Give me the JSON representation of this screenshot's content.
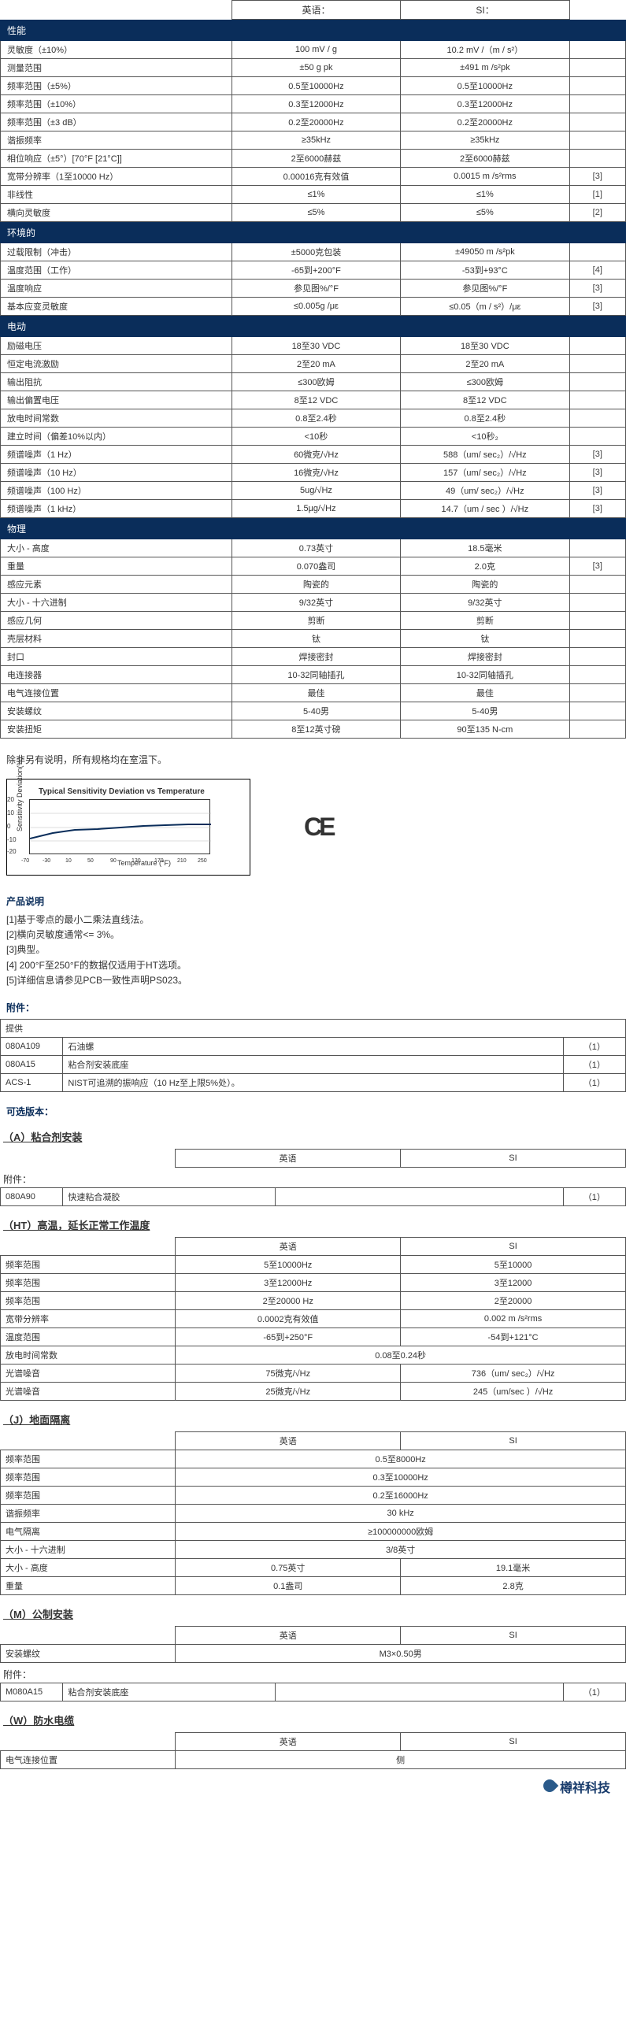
{
  "top_header": {
    "en_label": "英语：",
    "si_label": "SI："
  },
  "sections": [
    {
      "title": "性能",
      "rows": [
        {
          "label": "灵敏度（±10%）",
          "en": "100 mV / g",
          "si": "10.2 mV /（m / s²）",
          "note": ""
        },
        {
          "label": "测量范围",
          "en": "±50 g pk",
          "si": "±491 m /s²pk",
          "note": ""
        },
        {
          "label": "频率范围（±5%）",
          "en": "0.5至10000Hz",
          "si": "0.5至10000Hz",
          "note": ""
        },
        {
          "label": "频率范围（±10%）",
          "en": "0.3至12000Hz",
          "si": "0.3至12000Hz",
          "note": ""
        },
        {
          "label": "频率范围（±3 dB）",
          "en": "0.2至20000Hz",
          "si": "0.2至20000Hz",
          "note": ""
        },
        {
          "label": "谐振频率",
          "en": "≥35kHz",
          "si": "≥35kHz",
          "note": ""
        },
        {
          "label": "相位响应（±5°）[70°F [21°C]]",
          "en": "2至6000赫兹",
          "si": "2至6000赫兹",
          "note": ""
        },
        {
          "label": "宽带分辨率（1至10000 Hz）",
          "en": "0.00016克有效值",
          "si": "0.0015 m /s²rms",
          "note": "[3]"
        },
        {
          "label": "非线性",
          "en": "≤1%",
          "si": "≤1%",
          "note": "[1]"
        },
        {
          "label": "横向灵敏度",
          "en": "≤5%",
          "si": "≤5%",
          "note": "[2]"
        }
      ]
    },
    {
      "title": "环境的",
      "rows": [
        {
          "label": "过载限制（冲击）",
          "en": "±5000克包装",
          "si": "±49050 m /s²pk",
          "note": ""
        },
        {
          "label": "温度范围（工作）",
          "en": "-65到+200°F",
          "si": "-53到+93°C",
          "note": "[4]"
        },
        {
          "label": "温度响应",
          "en": "参见图%/°F",
          "si": "参见图%/°F",
          "note": "[3]"
        },
        {
          "label": "基本应变灵敏度",
          "en": "≤0.005g /με",
          "si": "≤0.05（m / s²）/με",
          "note": "[3]"
        }
      ]
    },
    {
      "title": "电动",
      "rows": [
        {
          "label": "励磁电压",
          "en": "18至30 VDC",
          "si": "18至30 VDC",
          "note": ""
        },
        {
          "label": "恒定电流激励",
          "en": "2至20 mA",
          "si": "2至20 mA",
          "note": ""
        },
        {
          "label": "输出阻抗",
          "en": "≤300欧姆",
          "si": "≤300欧姆",
          "note": ""
        },
        {
          "label": "输出偏置电压",
          "en": "8至12 VDC",
          "si": "8至12 VDC",
          "note": ""
        },
        {
          "label": "放电时间常数",
          "en": "0.8至2.4秒",
          "si": "0.8至2.4秒",
          "note": ""
        },
        {
          "label": "建立时间（偏差10%以内）",
          "en": "<10秒",
          "si": "<10秒₂",
          "note": ""
        },
        {
          "label": "频谱噪声（1 Hz）",
          "en": "60微克/√Hz",
          "si": "588（um/ sec₂）/√Hz",
          "note": "[3]"
        },
        {
          "label": "频谱噪声（10 Hz）",
          "en": "16微克/√Hz",
          "si": "157（um/ sec₂）/√Hz",
          "note": "[3]"
        },
        {
          "label": "频谱噪声（100 Hz）",
          "en": "5ug/√Hz",
          "si": "49（um/ sec₂）/√Hz",
          "note": "[3]"
        },
        {
          "label": "频谱噪声（1 kHz）",
          "en": "1.5µg/√Hz",
          "si": "14.7（um / sec ）/√Hz",
          "note": "[3]"
        }
      ]
    },
    {
      "title": "物理",
      "rows": [
        {
          "label": "大小 - 高度",
          "en": "0.73英寸",
          "si": "18.5毫米",
          "note": ""
        },
        {
          "label": "重量",
          "en": "0.070盎司",
          "si": "2.0克",
          "note": "[3]"
        },
        {
          "label": "感应元素",
          "en": "陶瓷的",
          "si": "陶瓷的",
          "note": ""
        },
        {
          "label": "大小 - 十六进制",
          "en": "9/32英寸",
          "si": "9/32英寸",
          "note": ""
        },
        {
          "label": "感应几何",
          "en": "剪断",
          "si": "剪断",
          "note": ""
        },
        {
          "label": "壳层材料",
          "en": "钛",
          "si": "钛",
          "note": ""
        },
        {
          "label": "封口",
          "en": "焊接密封",
          "si": "焊接密封",
          "note": ""
        },
        {
          "label": "电连接器",
          "en": "10-32同轴插孔",
          "si": "10-32同轴插孔",
          "note": ""
        },
        {
          "label": "电气连接位置",
          "en": "最佳",
          "si": "最佳",
          "note": ""
        },
        {
          "label": "安装螺纹",
          "en": "5-40男",
          "si": "5-40男",
          "note": ""
        },
        {
          "label": "安装扭矩",
          "en": "8至12英寸磅",
          "si": "90至135 N-cm",
          "note": ""
        }
      ]
    }
  ],
  "room_temp_note": "除非另有说明，所有规格均在室温下。",
  "chart": {
    "title": "Typical Sensitivity Deviation vs Temperature",
    "xlabel": "Temperature (°F)",
    "ylabel": "Sensitivity Deviation(%)"
  },
  "chart_data": {
    "type": "line",
    "title": "Typical Sensitivity Deviation vs Temperature",
    "xlabel": "Temperature (°F)",
    "ylabel": "Sensitivity Deviation(%)",
    "x": [
      -70,
      -30,
      10,
      50,
      90,
      130,
      170,
      210,
      250
    ],
    "y": [
      -8,
      -4,
      -2,
      -1,
      0,
      1,
      1.5,
      2,
      2
    ],
    "xlim": [
      -70,
      250
    ],
    "ylim": [
      -20,
      20
    ],
    "y_ticks": [
      -20,
      -10,
      0,
      10,
      20
    ]
  },
  "notes_title": "产品说明",
  "notes": [
    "[1]基于零点的最小二乘法直线法。",
    "[2]横向灵敏度通常<= 3%。",
    "[3]典型。",
    "[4] 200°F至250°F的数据仅适用于HT选项。",
    "[5]详细信息请参见PCB一致性声明PS023。"
  ],
  "accessories_title": "附件：",
  "accessories_supply": "提供",
  "accessories": [
    {
      "id": "080A109",
      "desc": "石油螺",
      "qty": "（1）"
    },
    {
      "id": "080A15",
      "desc": "粘合剂安装底座",
      "qty": "（1）"
    },
    {
      "id": "ACS-1",
      "desc": "NIST可追溯的振响应（10 Hz至上限5%处）。",
      "qty": "（1）"
    }
  ],
  "options_title": "可选版本：",
  "option_a": {
    "title": "（A）粘合剂安装",
    "hdr_en": "英语",
    "hdr_si": "SI",
    "acc_label": "附件：",
    "rows": [
      {
        "id": "080A90",
        "desc": "快速粘合凝胶",
        "qty": "（1）"
      }
    ]
  },
  "option_ht": {
    "title": "（HT）高温，延长正常工作温度",
    "hdr_en": "英语",
    "hdr_si": "SI",
    "rows": [
      {
        "label": "频率范围",
        "en": "5至10000Hz",
        "si": "5至10000"
      },
      {
        "label": "频率范围",
        "en": "3至12000Hz",
        "si": "3至12000"
      },
      {
        "label": "频率范围",
        "en": "2至20000 Hz",
        "si": "2至20000"
      },
      {
        "label": "宽带分辨率",
        "en": "0.0002克有效值",
        "si": "0.002 m /s²rms"
      },
      {
        "label": "温度范围",
        "en": "-65到+250°F",
        "si": "-54到+121°C"
      },
      {
        "label": "放电时间常数",
        "en_span": "0.08至0.24秒",
        "si": "₂"
      },
      {
        "label": "光谱噪音",
        "en": "75微克/√Hz",
        "si": "736（um/ sec₂）/√Hz"
      },
      {
        "label": "光谱噪音",
        "en": "25微克/√Hz",
        "si": "245（um/sec ）/√Hz"
      }
    ]
  },
  "option_j": {
    "title": "（J）地面隔离",
    "hdr_en": "英语",
    "hdr_si": "SI",
    "rows": [
      {
        "label": "频率范围",
        "val": "0.5至8000Hz"
      },
      {
        "label": "频率范围",
        "val": "0.3至10000Hz"
      },
      {
        "label": "频率范围",
        "val": "0.2至16000Hz"
      },
      {
        "label": "谐振频率",
        "val": "30 kHz"
      },
      {
        "label": "电气隔离",
        "val": "≥100000000欧姆"
      },
      {
        "label": "大小 - 十六进制",
        "val": "3/8英寸"
      },
      {
        "label": "大小 - 高度",
        "en": "0.75英寸",
        "si": "19.1毫米"
      },
      {
        "label": "重量",
        "en": "0.1盎司",
        "si": "2.8克"
      }
    ]
  },
  "option_m": {
    "title": "（M）公制安装",
    "hdr_en": "英语",
    "hdr_si": "SI",
    "rows": [
      {
        "label": "安装螺纹",
        "val": "M3×0.50男"
      }
    ],
    "acc_label": "附件：",
    "acc_rows": [
      {
        "id": "M080A15",
        "desc": "粘合剂安装底座",
        "qty": "（1）"
      }
    ]
  },
  "option_w": {
    "title": "（W）防水电缆",
    "hdr_en": "英语",
    "hdr_si": "SI",
    "rows": [
      {
        "label": "电气连接位置",
        "val": "侧"
      }
    ]
  },
  "footer_text": "樽祥科技"
}
